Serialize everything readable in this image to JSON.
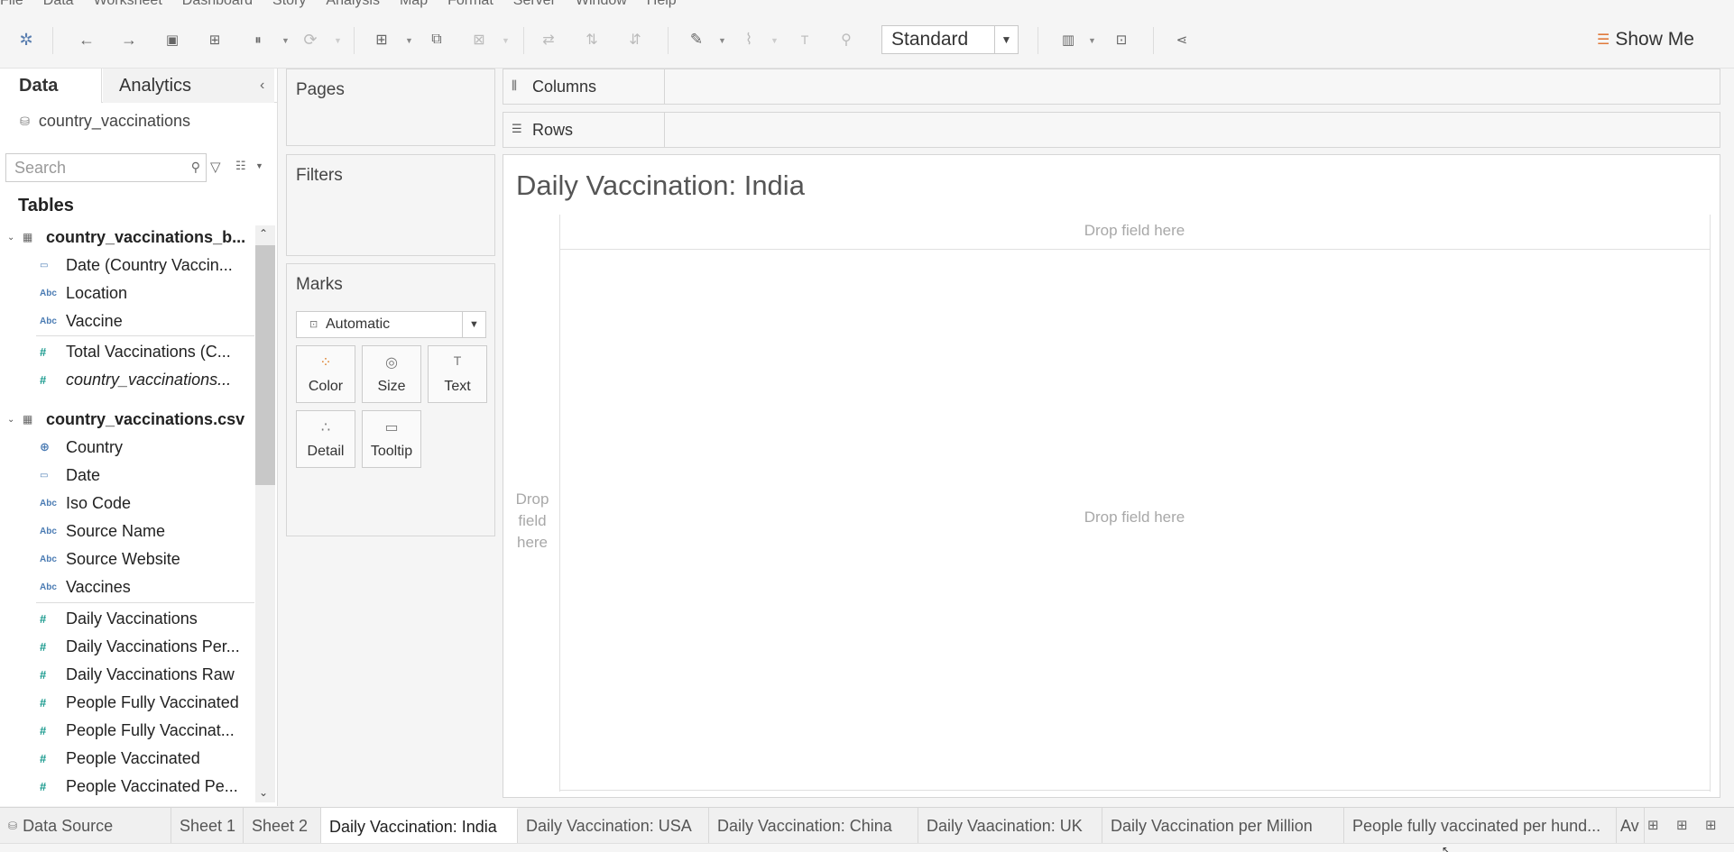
{
  "menu": [
    "File",
    "Data",
    "Worksheet",
    "Dashboard",
    "Story",
    "Analysis",
    "Map",
    "Format",
    "Server",
    "Window",
    "Help"
  ],
  "toolbar": {
    "fit_select_value": "Standard",
    "show_me_label": "Show Me",
    "icons": [
      "tableau-logo-icon",
      "undo-icon",
      "redo-icon",
      "save-icon",
      "new-datasource-icon",
      "pause-updates-icon",
      "refresh-icon",
      "new-worksheet-icon",
      "duplicate-sheet-icon",
      "clear-sheet-icon",
      "swap-rows-columns-icon",
      "sort-ascending-icon",
      "sort-descending-icon",
      "highlight-icon",
      "group-members-icon",
      "show-labels-icon",
      "fix-axes-icon",
      "show-cards-icon",
      "presentation-mode-icon",
      "share-icon",
      "show-me-icon"
    ]
  },
  "data_pane": {
    "tab_data": "Data",
    "tab_analytics": "Analytics",
    "datasource_name": "country_vaccinations",
    "search_placeholder": "Search",
    "tables_heading": "Tables",
    "table1": {
      "name": "country_vaccinations_b...",
      "fields": [
        {
          "icon": "date",
          "label": "Date (Country Vaccin..."
        },
        {
          "icon": "abc",
          "label": "Location"
        },
        {
          "icon": "abc",
          "label": "Vaccine"
        },
        {
          "icon": "measure",
          "label": "Total Vaccinations (C..."
        },
        {
          "icon": "measure",
          "label": "country_vaccinations..."
        }
      ]
    },
    "table2": {
      "name": "country_vaccinations.csv",
      "fields": [
        {
          "icon": "geo",
          "label": "Country"
        },
        {
          "icon": "date",
          "label": "Date"
        },
        {
          "icon": "abc",
          "label": "Iso Code"
        },
        {
          "icon": "abc",
          "label": "Source Name"
        },
        {
          "icon": "abc",
          "label": "Source Website"
        },
        {
          "icon": "abc",
          "label": "Vaccines"
        },
        {
          "icon": "measure",
          "label": "Daily Vaccinations"
        },
        {
          "icon": "measure",
          "label": "Daily Vaccinations Per..."
        },
        {
          "icon": "measure",
          "label": "Daily Vaccinations Raw"
        },
        {
          "icon": "measure",
          "label": "People Fully Vaccinated"
        },
        {
          "icon": "measure",
          "label": "People Fully Vaccinat..."
        },
        {
          "icon": "measure",
          "label": "People Vaccinated"
        },
        {
          "icon": "measure",
          "label": "People Vaccinated Pe..."
        }
      ]
    }
  },
  "cards": {
    "pages": "Pages",
    "filters": "Filters",
    "marks": "Marks",
    "mark_type": "Automatic",
    "buttons": {
      "color": "Color",
      "size": "Size",
      "text": "Text",
      "detail": "Detail",
      "tooltip": "Tooltip"
    }
  },
  "shelves": {
    "columns": "Columns",
    "rows": "Rows"
  },
  "viz": {
    "title": "Daily Vaccination: India",
    "drop_top": "Drop field here",
    "drop_center": "Drop field here",
    "drop_left": "Drop field here"
  },
  "tabs": {
    "datasource": "Data Source",
    "sheets": [
      "Sheet 1",
      "Sheet 2",
      "Daily Vaccination: India",
      "Daily Vaccination: USA",
      "Daily Vaccination: China",
      "Daily Vaacination: UK",
      "Daily Vaccination per Million",
      "People fully vaccinated per hund...",
      "Av"
    ],
    "active_index": 2
  }
}
